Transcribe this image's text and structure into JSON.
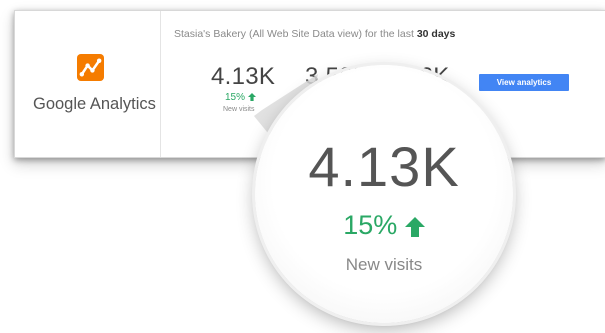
{
  "brand": {
    "name": "Google Analytics",
    "logo_color": "#F57C00",
    "logo_icon": "google-analytics-logo-icon"
  },
  "header": {
    "text": "Stasia's Bakery (All Web Site Data view) for the last ",
    "period": "30 days"
  },
  "metrics": [
    {
      "value": "4.13K",
      "change": "15%",
      "trend": "up",
      "label": "New visits"
    },
    {
      "value": "3.58K"
    },
    {
      "value": "3.6K"
    }
  ],
  "actions": {
    "view_analytics": "View analytics"
  },
  "magnifier": {
    "value": "4.13K",
    "change": "15%",
    "trend": "up",
    "label": "New visits"
  },
  "colors": {
    "accent": "#4285F4",
    "positive": "#2AA865",
    "text": "#444444"
  }
}
